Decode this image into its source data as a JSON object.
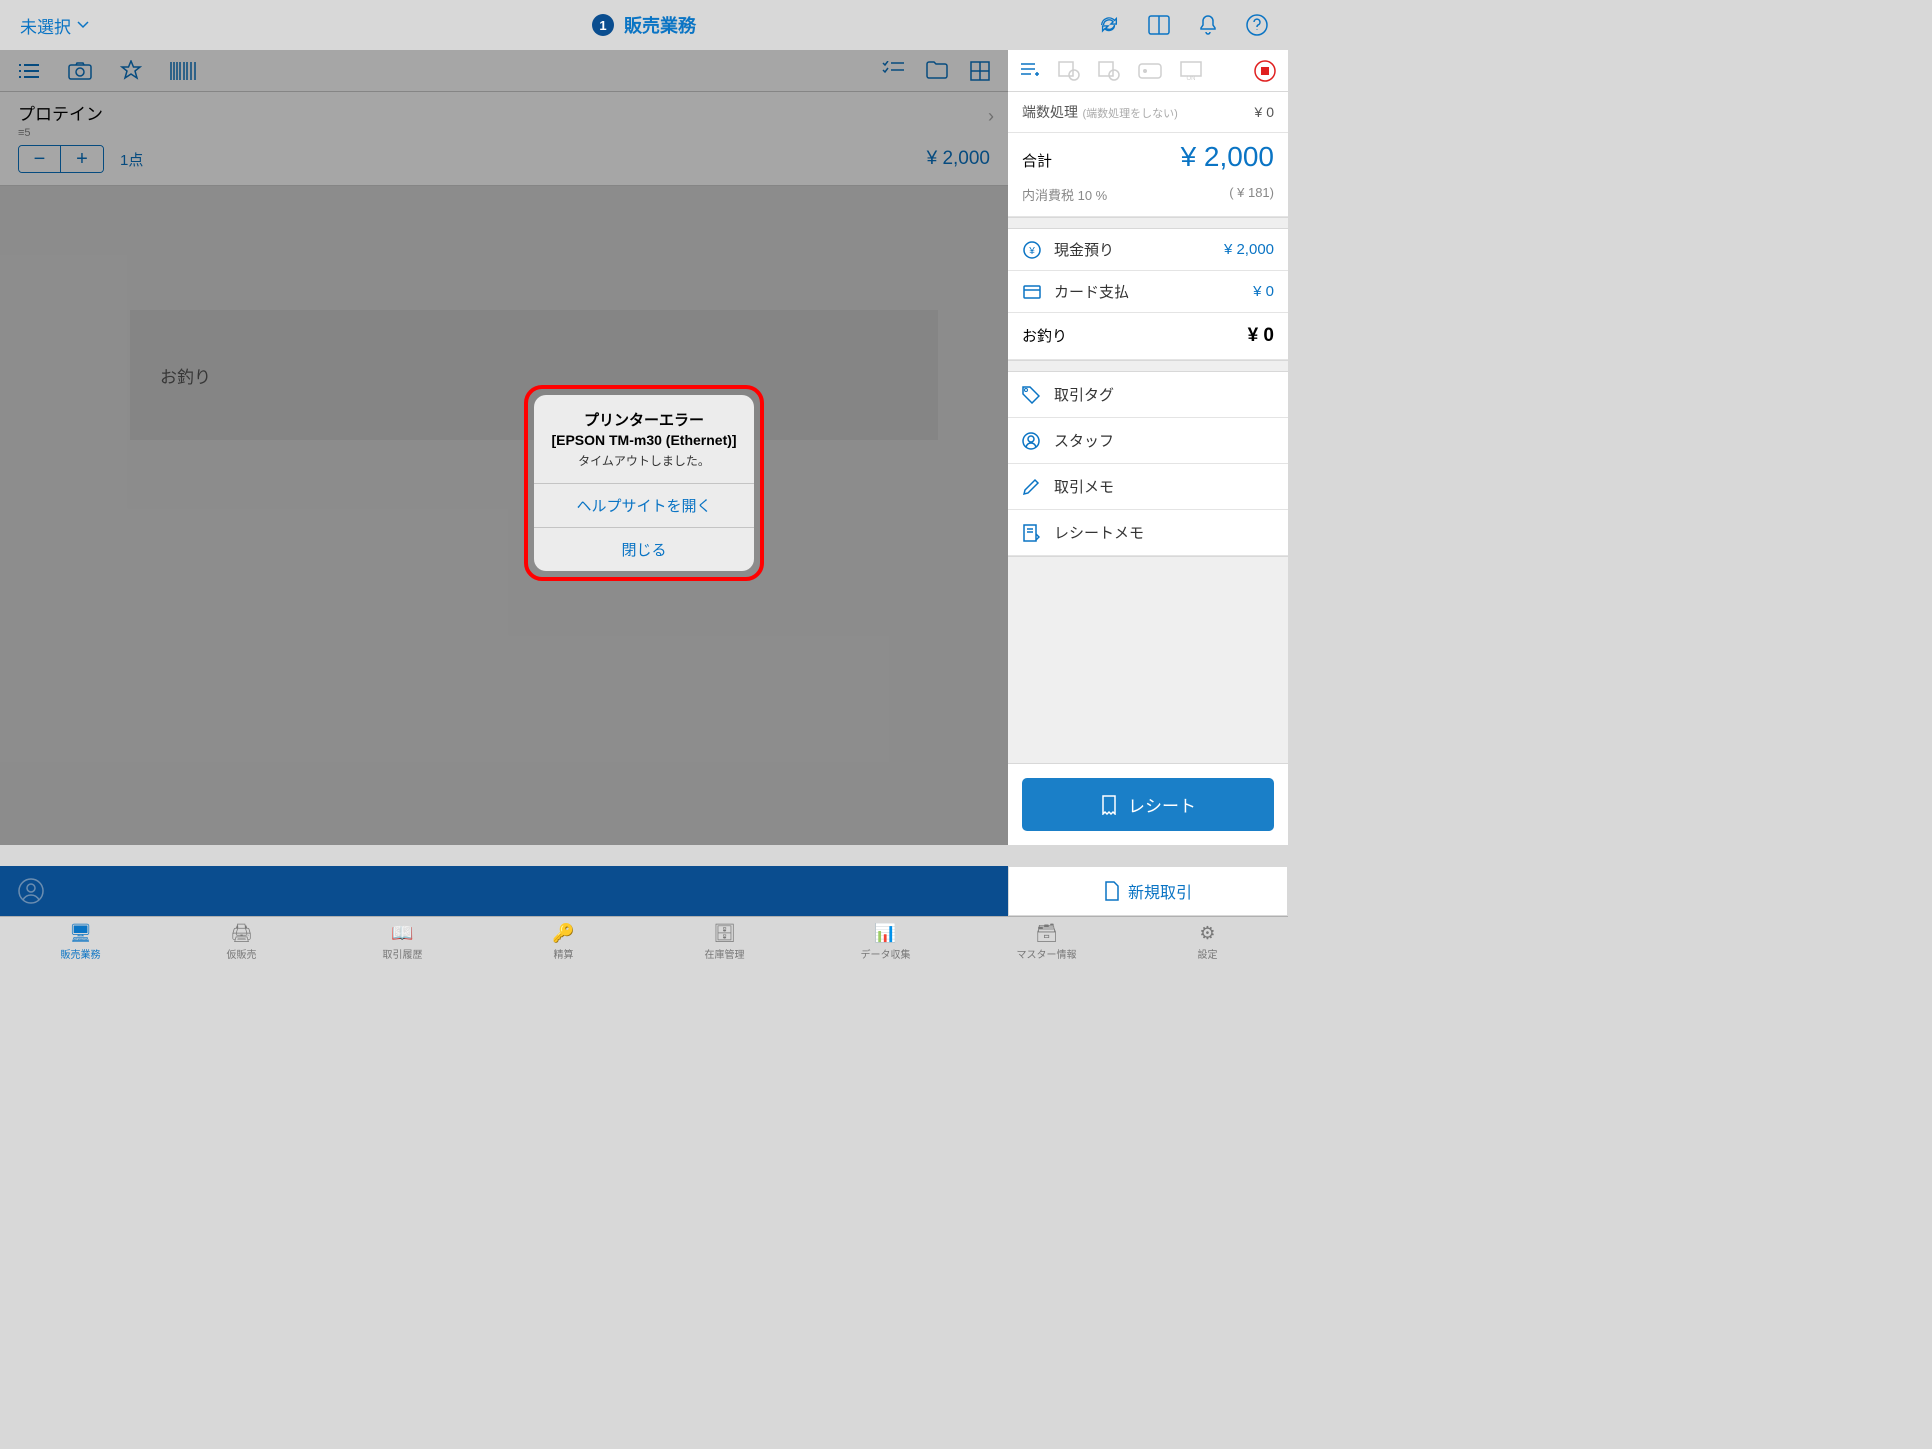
{
  "header": {
    "selector": "未選択",
    "badge": "1",
    "title": "販売業務"
  },
  "item": {
    "name": "プロテイン",
    "sub": "≡5",
    "qty": "1点",
    "price": "¥ 2,000"
  },
  "change_label": "お釣り",
  "summary": {
    "round_label": "端数処理",
    "round_hint": "(端数処理をしない)",
    "round_val": "¥ 0",
    "total_label": "合計",
    "total_val": "¥ 2,000",
    "tax_label": "内消費税 10 %",
    "tax_val": "( ¥ 181)",
    "cash_label": "現金預り",
    "cash_val": "¥ 2,000",
    "card_label": "カード支払",
    "card_val": "¥ 0",
    "change_label": "お釣り",
    "change_val": "¥ 0"
  },
  "actions": {
    "tag": "取引タグ",
    "staff": "スタッフ",
    "memo": "取引メモ",
    "receipt_memo": "レシートメモ"
  },
  "buttons": {
    "receipt": "レシート",
    "new": "新規取引"
  },
  "tabs": [
    "販売業務",
    "仮販売",
    "取引履歴",
    "精算",
    "在庫管理",
    "データ収集",
    "マスター情報",
    "設定"
  ],
  "modal": {
    "title": "プリンターエラー",
    "subtitle": "[EPSON TM-m30 (Ethernet)]",
    "message": "タイムアウトしました。",
    "help": "ヘルプサイトを開く",
    "close": "閉じる"
  }
}
